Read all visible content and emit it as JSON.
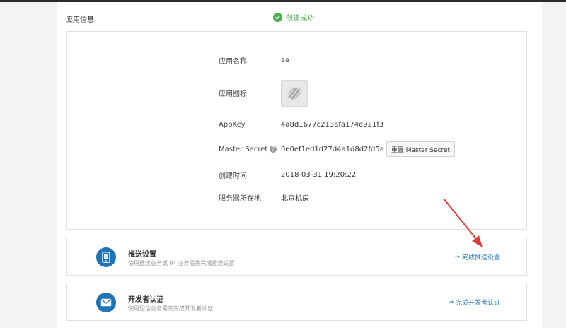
{
  "page": {
    "title": "应用信息"
  },
  "notice": {
    "success_text": "创建成功！"
  },
  "app_info": {
    "name_label": "应用名称",
    "name_value": "aa",
    "icon_label": "应用图标",
    "appkey_label": "AppKey",
    "appkey_value": "4a8d1677c213afa174e921f3",
    "secret_label": "Master Secret",
    "secret_help": "?",
    "secret_value": "0e0ef1ed1d27d4a1d8d2fd5a",
    "reset_button": "重置 Master Secret",
    "created_label": "创建时间",
    "created_value": "2018-03-31 19:20:22",
    "region_label": "服务器所在地",
    "region_value": "北京机房"
  },
  "steps": [
    {
      "icon": "phone-icon",
      "title": "推送设置",
      "desc": "使用推送业务或 IM 业务需先完成推送设置",
      "link": "完成推送设置"
    },
    {
      "icon": "mail-icon",
      "title": "开发者认证",
      "desc": "使用短信业务需先完成开发者认证",
      "link": "完成开发者认证"
    }
  ],
  "colors": {
    "accent": "#1f73b7",
    "success": "#4caf50",
    "annotation": "#e53935"
  }
}
